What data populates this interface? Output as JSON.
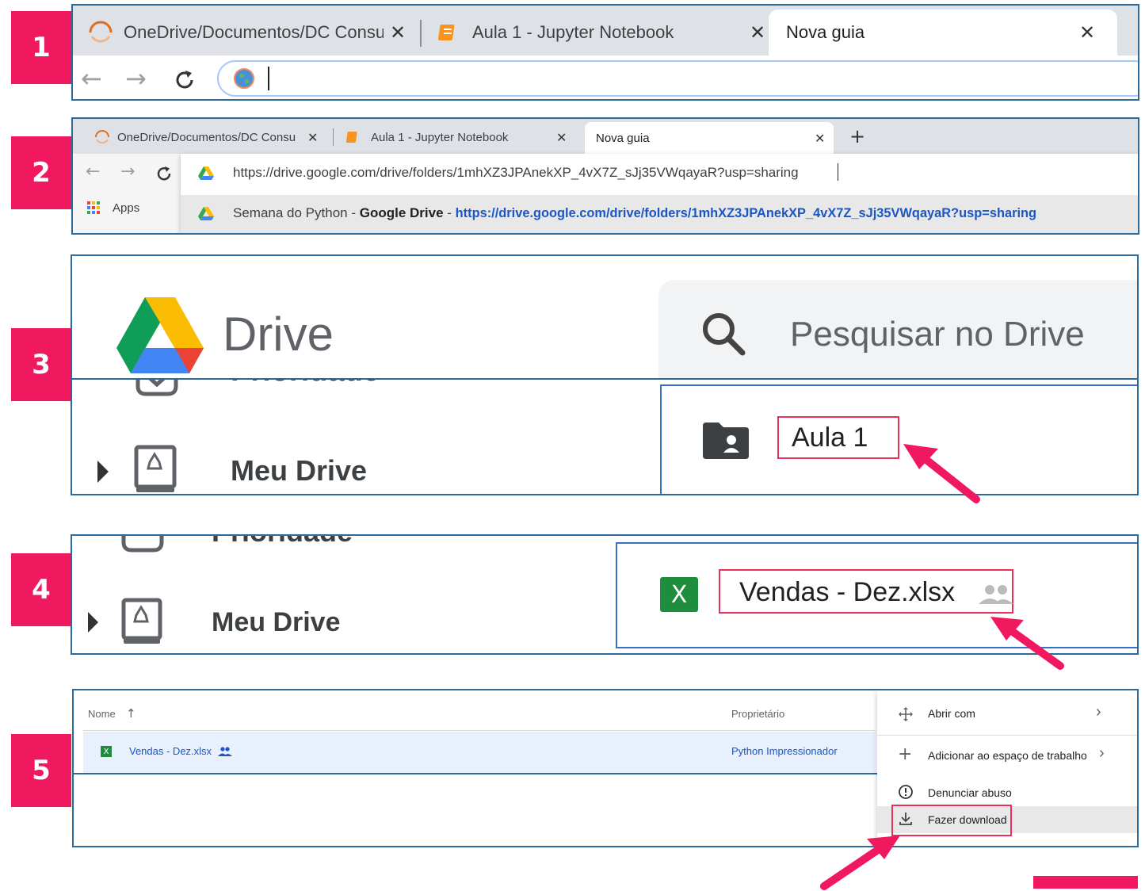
{
  "steps": [
    "1",
    "2",
    "3",
    "4",
    "5"
  ],
  "browser_large": {
    "tabs": [
      {
        "title": "OneDrive/Documentos/DC Consu",
        "close": "✕"
      },
      {
        "title": "Aula 1 - Jupyter Notebook",
        "close": "✕"
      },
      {
        "title": "Nova guia",
        "close": "✕"
      }
    ],
    "nav": {
      "back": "←",
      "forward": "→",
      "reload": "C"
    }
  },
  "browser_small": {
    "tabs": [
      {
        "title": "OneDrive/Documentos/DC Consu",
        "close": "✕"
      },
      {
        "title": "Aula 1 - Jupyter Notebook",
        "close": "✕"
      },
      {
        "title": "Nova guia",
        "close": "✕"
      }
    ],
    "new_tab": "+",
    "nav": {
      "back": "←",
      "forward": "→",
      "reload": "C"
    },
    "address_value": "https://drive.google.com/drive/folders/1mhXZ3JPAnekXP_4vX7Z_sJj35VWqayaR?usp=sharing",
    "apps_label": "Apps",
    "suggestion": {
      "prefix": "Semana do Python - ",
      "bold": "Google Drive",
      "sep": " - ",
      "url": "https://drive.google.com/drive/folders/1mhXZ3JPAnekXP_4vX7Z_sJj35VWqayaR?usp=sharing"
    }
  },
  "drive": {
    "logo_text": "Drive",
    "search_placeholder": "Pesquisar no Drive",
    "clipped_label": "Prioridade",
    "my_drive": "Meu Drive",
    "folder_name": "Aula 1"
  },
  "step4": {
    "clipped_label": "Prioridade",
    "my_drive": "Meu Drive",
    "file_name": "Vendas - Dez.xlsx",
    "excel_letter": "X"
  },
  "step5": {
    "col_name": "Nome",
    "col_owner": "Proprietário",
    "sort_arrow": "↑",
    "row_name": "Vendas - Dez.xlsx",
    "row_owner": "Python Impressionador",
    "excel_letter": "X",
    "menu": [
      {
        "label": "Abrir com",
        "icon": "move-icon",
        "arrow": "›"
      },
      {
        "label": "Adicionar ao espaço de trabalho",
        "icon": "plus-icon",
        "arrow": "›"
      },
      {
        "label": "Denunciar abuso",
        "icon": "alert-icon"
      },
      {
        "label": "Fazer download",
        "icon": "download-icon"
      }
    ]
  },
  "colors": {
    "accent": "#f0185e",
    "panel_border": "#2d6a9a",
    "highlight": "#e8305f",
    "link": "#1a56c6"
  }
}
